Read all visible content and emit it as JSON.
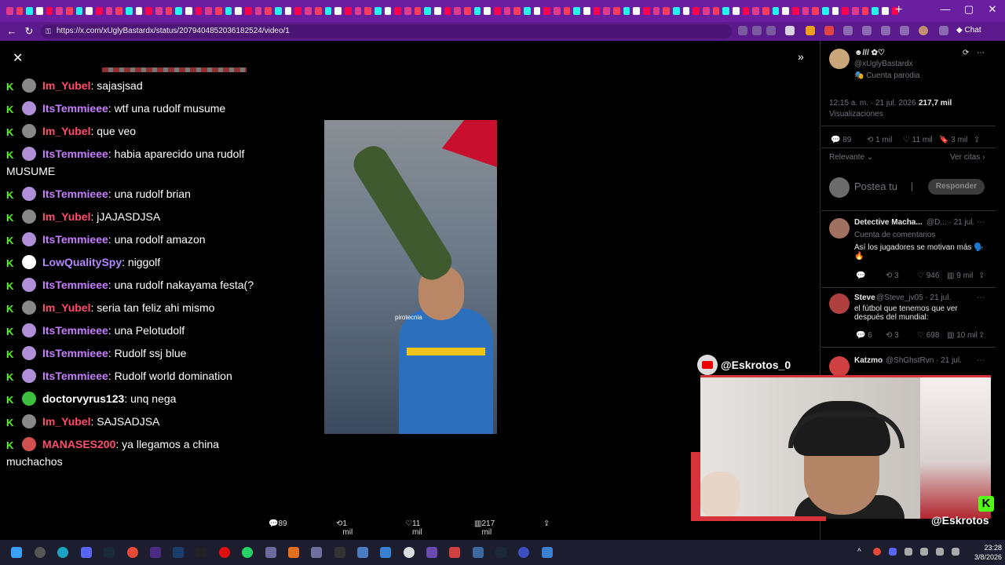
{
  "browser": {
    "url": "https://x.com/xUglyBastardx/status/2079404852036182524/video/1",
    "chat_label": "Chat",
    "window_controls": [
      "—",
      "▢",
      "✕"
    ]
  },
  "chat": {
    "messages": [
      {
        "user": "Im_Yubel",
        "text": "sajasjsad",
        "color": "#ff4d6d"
      },
      {
        "user": "ItsTemmieee",
        "text": "wtf una rudolf musume",
        "color": "#c77dff"
      },
      {
        "user": "Im_Yubel",
        "text": "que veo",
        "color": "#ff4d6d"
      },
      {
        "user": "ItsTemmieee",
        "text": "habia aparecido una rudolf MUSUME",
        "color": "#c77dff"
      },
      {
        "user": "ItsTemmieee",
        "text": "una rudolf brian",
        "color": "#c77dff"
      },
      {
        "user": "Im_Yubel",
        "text": "jJAJASDJSA",
        "color": "#ff4d6d"
      },
      {
        "user": "ItsTemmieee",
        "text": "una rodolf amazon",
        "color": "#c77dff"
      },
      {
        "user": "LowQualitySpy",
        "text": "niggolf",
        "color": "#b388ff"
      },
      {
        "user": "ItsTemmieee",
        "text": "una rudolf nakayama festa(?",
        "color": "#c77dff"
      },
      {
        "user": "Im_Yubel",
        "text": "seria tan feliz ahi mismo",
        "color": "#ff4d6d"
      },
      {
        "user": "ItsTemmieee",
        "text": "una Pelotudolf",
        "color": "#c77dff"
      },
      {
        "user": "ItsTemmieee",
        "text": "Rudolf ssj blue",
        "color": "#c77dff"
      },
      {
        "user": "ItsTemmieee",
        "text": "Rudolf world domination",
        "color": "#c77dff"
      },
      {
        "user": "doctorvyrus123",
        "text": "unq nega",
        "color": "#ffffff"
      },
      {
        "user": "Im_Yubel",
        "text": "SAJSADJSA",
        "color": "#ff4d6d"
      },
      {
        "user": "MANASES200",
        "text": "ya llegamos a china muchachos",
        "color": "#ff4d6d"
      }
    ]
  },
  "video": {
    "caption": "pirotecnia"
  },
  "actions": {
    "replies": "89",
    "reposts": "1 mil",
    "likes": "11 mil",
    "views": "217 mil"
  },
  "tweet": {
    "display_name": "☻/// ✿♡",
    "handle": "@xUglyBastardx",
    "badge": "Cuenta parodia",
    "time": "12:15 a. m. · 21 jul. 2026 ·",
    "views_count": "217,7 mil",
    "views_label": "Visualizaciones",
    "replies": "89",
    "reposts": "1 mil",
    "likes": "11 mil",
    "bookmarks": "3 mil",
    "sort": "Relevante",
    "quotes": "Ver citas",
    "reply_placeholder": "Postea tu",
    "reply_button": "Responder"
  },
  "replies": [
    {
      "name": "Detective Macha...",
      "handle": "@D... · 21 jul.",
      "sub": "Cuenta de comentarios",
      "text": "Así los jugadores se motivan más 🗣️🔥",
      "stats": [
        "",
        "3",
        "946",
        "9 mil"
      ]
    },
    {
      "name": "Steve",
      "handle": "@Steve_jv05 · 21 jul.",
      "sub": "",
      "text": "el fútbol que tenemos que ver después del mundial:",
      "stats": [
        "6",
        "3",
        "698",
        "10 mil"
      ]
    },
    {
      "name": "Katzmo",
      "handle": "@ShGhstRvn · 21 jul.",
      "sub": "",
      "text": "",
      "stats": []
    }
  ],
  "webcam": {
    "label": "@Eskrotos_0",
    "handle": "@Eskrotos"
  },
  "clock": {
    "time": "23:28",
    "date": "3/8/2026"
  }
}
